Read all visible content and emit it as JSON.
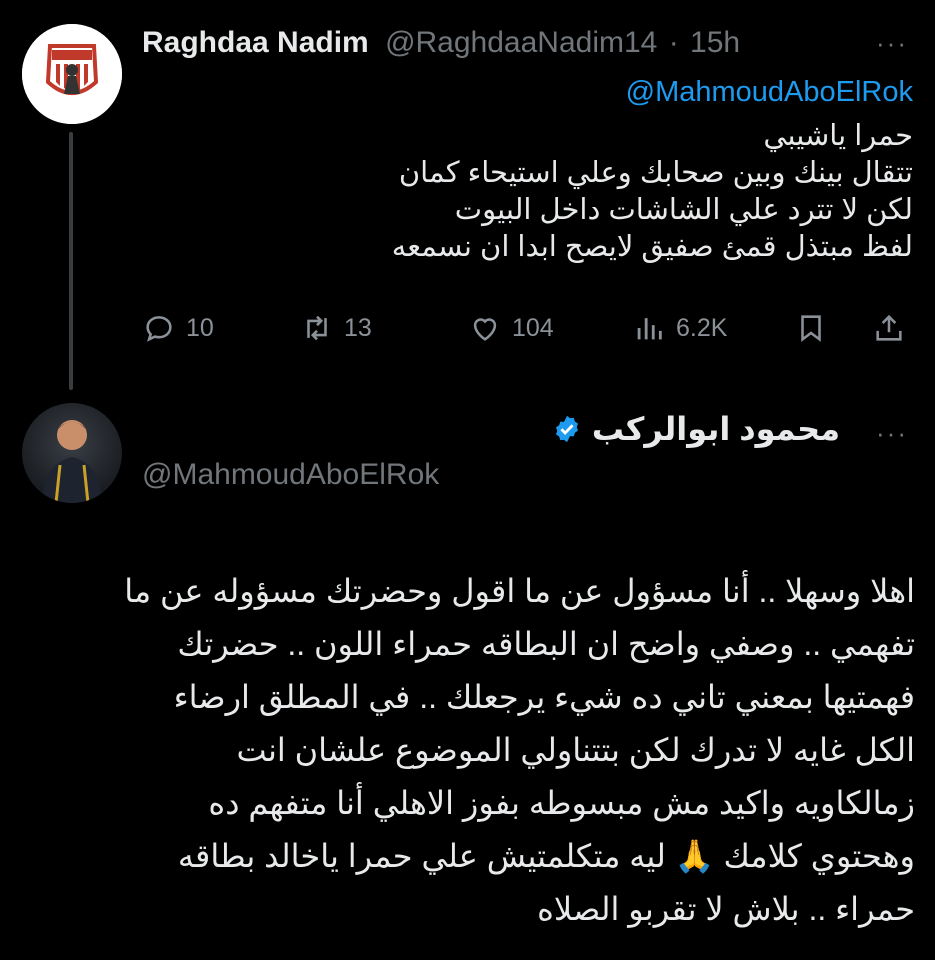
{
  "tweet1": {
    "display_name": "Raghdaa Nadim",
    "handle": "@RaghdaaNadim14",
    "separator": "·",
    "time": "15h",
    "more_label": "···",
    "reply_to": "@MahmoudAboElRok",
    "lines": [
      "حمرا ياشيبي",
      "تتقال بينك وبين صحابك وعلي استيحاء كمان",
      "لكن لا تترد علي الشاشات داخل البيوت",
      "لفظ مبتذل قمئ صفيق لايصح ابدا ان نسمعه"
    ],
    "actions": {
      "replies": "10",
      "retweets": "13",
      "likes": "104",
      "views": "6.2K"
    }
  },
  "tweet2": {
    "display_name": "محمود ابوالركب",
    "handle": "@MahmoudAboElRok",
    "more_label": "···",
    "verified_color": "#1d9bf0",
    "lines": [
      "اهلا وسهلا .. أنا مسؤول عن ما اقول وحضرتك مسؤوله عن ما",
      "تفهمي .. وصفي واضح ان البطاقه حمراء اللون .. حضرتك",
      "فهمتيها بمعني تاني ده شيء يرجعلك .. في المطلق ارضاء",
      "الكل غايه لا تدرك لكن بتتناولي الموضوع علشان انت",
      "زمالكاويه واكيد مش مبسوطه بفوز الاهلي أنا متفهم ده",
      "وهحتوي كلامك 🙏 ليه متكلمتيش علي حمرا ياخالد بطاقه",
      "حمراء .. بلاش لا تقربو الصلاه"
    ]
  },
  "colors": {
    "background": "#000000",
    "text": "#e7e9ea",
    "muted": "#71767b",
    "link": "#1d9bf0"
  }
}
